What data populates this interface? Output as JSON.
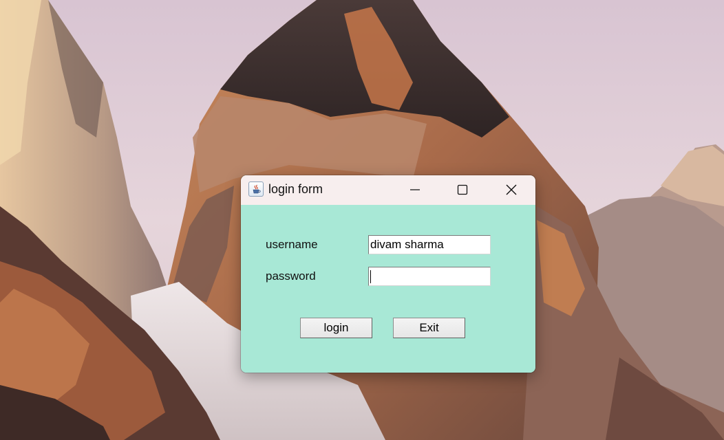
{
  "window": {
    "title": "login form",
    "app_icon": "java-coffee-cup-icon"
  },
  "caption_buttons": {
    "minimize_icon": "minimize-icon",
    "maximize_icon": "maximize-icon",
    "close_icon": "close-icon"
  },
  "form": {
    "username_label": "username",
    "username_value": "divam sharma",
    "password_label": "password",
    "password_value": "",
    "login_label": "login",
    "exit_label": "Exit"
  },
  "colors": {
    "content_background": "#a8e8d6",
    "titlebar_background": "#f7eeee"
  }
}
